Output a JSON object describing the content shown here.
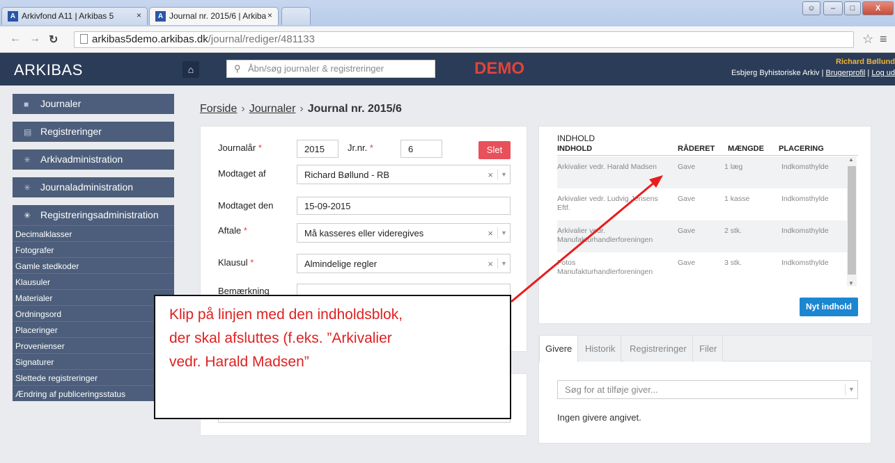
{
  "browser": {
    "tabs": [
      {
        "title": "Arkivfond A11 | Arkibas 5",
        "close": "×"
      },
      {
        "title": "Journal nr. 2015/6 | Arkiba",
        "close": "×"
      }
    ],
    "url_host": "arkibas5demo.arkibas.dk",
    "url_path": "/journal/rediger/481133",
    "fav": "A"
  },
  "header": {
    "logo": "ARKIBAS",
    "search_placeholder": "Åbn/søg journaler & registreringer",
    "demo": "DEMO",
    "user_name": "Richard Bøllund",
    "archive": "Esbjerg Byhistoriske Arkiv",
    "profile_link": "Brugerprofil",
    "logout_link": "Log ud"
  },
  "sidebar": {
    "main": [
      {
        "label": "Journaler"
      },
      {
        "label": "Registreringer"
      },
      {
        "label": "Arkivadministration"
      },
      {
        "label": "Journaladministration"
      },
      {
        "label": "Registreringsadministration"
      }
    ],
    "sub": [
      "Decimalklasser",
      "Fotografer",
      "Gamle stedkoder",
      "Klausuler",
      "Materialer",
      "Ordningsord",
      "Placeringer",
      "Provenienser",
      "Signaturer",
      "Slettede registreringer",
      "Ændring af publiceringsstatus"
    ]
  },
  "breadcrumb": {
    "home": "Forside",
    "journals": "Journaler",
    "current": "Journal nr. 2015/6",
    "sep": "›"
  },
  "form": {
    "journalaar_label": "Journalår",
    "journalaar_value": "2015",
    "jrnr_label": "Jr.nr.",
    "jrnr_value": "6",
    "delete_label": "Slet",
    "modtaget_af_label": "Modtaget af",
    "modtaget_af_value": "Richard Bøllund - RB",
    "modtaget_den_label": "Modtaget den",
    "modtaget_den_value": "15-09-2015",
    "aftale_label": "Aftale",
    "aftale_value": "Må kasseres eller videregives",
    "klausul_label": "Klausul",
    "klausul_value": "Almindelige regler",
    "bemaerkning_label": "Bemærkning",
    "required_mark": "*",
    "clear": "×"
  },
  "content": {
    "title": "INDHOLD",
    "columns": [
      "INDHOLD",
      "RÅDERET",
      "MÆNGDE",
      "PLACERING"
    ],
    "rows": [
      {
        "indhold": "Arkivalier vedr. Harald Madsen",
        "raaderet": "Gave",
        "maengde": "1 læg",
        "placering": "Indkomsthylde"
      },
      {
        "indhold": "Arkivalier vedr. Ludvig Jensens Eftf.",
        "raaderet": "Gave",
        "maengde": "1 kasse",
        "placering": "Indkomsthylde"
      },
      {
        "indhold": "Arkivalier vedr. Manufakturhandlerforeningen",
        "raaderet": "Gave",
        "maengde": "2 stk.",
        "placering": "Indkomsthylde"
      },
      {
        "indhold": "Fotos Manufakturhandlerforeningen",
        "raaderet": "Gave",
        "maengde": "3 stk.",
        "placering": "Indkomsthylde"
      }
    ],
    "new_button": "Nyt indhold"
  },
  "tabs_panel": {
    "tabs": [
      "Givere",
      "Historik",
      "Registreringer",
      "Filer"
    ],
    "giver_placeholder": "Søg for at tilføje giver...",
    "empty_text": "Ingen givere angivet."
  },
  "callout": {
    "line1": "Klip på linjen med den indholdsblok,",
    "line2": "der skal afsluttes (f.eks. ”Arkivalier",
    "line3": "vedr. Harald Madsen”"
  },
  "colors": {
    "header_bg": "#2a3c57",
    "sidebar_bg": "#4c5e7b",
    "demo_red": "#e0433b",
    "delete_red": "#e8505b",
    "primary_blue": "#1c86d1",
    "callout_red": "#e02020",
    "username_orange": "#f0b23a"
  }
}
